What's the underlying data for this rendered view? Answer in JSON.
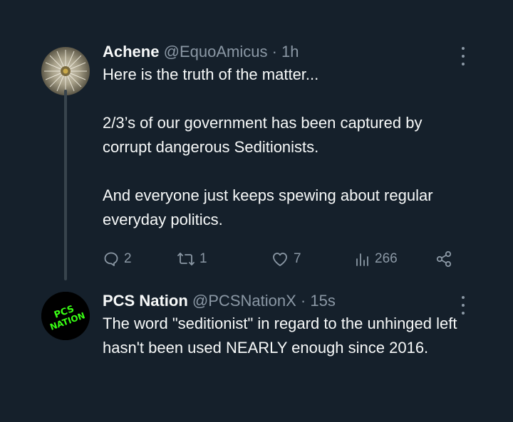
{
  "tweets": [
    {
      "name": "Achene",
      "handle": "@EquoAmicus",
      "separator": "·",
      "time": "1h",
      "paragraphs": [
        "Here is the truth of the matter...",
        "2/3’s of our government has been captured by corrupt dangerous Seditionists.",
        "And everyone just keeps spewing about regular everyday politics."
      ],
      "actions": {
        "replies": "2",
        "reposts": "1",
        "likes": "7",
        "views": "266"
      },
      "avatar_icon": "dandelion-seed-head"
    },
    {
      "name": "PCS Nation",
      "handle": "@PCSNationX",
      "separator": "·",
      "time": "15s",
      "paragraphs": [
        "The word \"seditionist\" in regard to the unhinged left hasn't been used NEARLY enough since 2016."
      ],
      "avatar_text": "PCS NATION",
      "avatar_icon": "pcs-nation-logo"
    }
  ],
  "colors": {
    "background": "#15202b",
    "text_primary": "#f7f9f9",
    "text_secondary": "#8b98a5",
    "thread_line": "#38444d",
    "logo_green": "#39ff14"
  }
}
